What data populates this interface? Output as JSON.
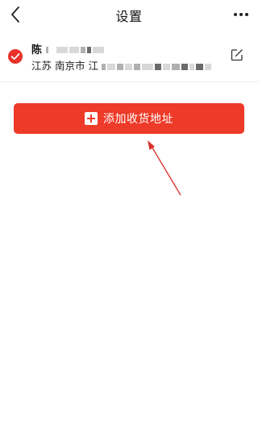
{
  "nav": {
    "title": "设置",
    "back_icon": "chevron-left-icon",
    "more_icon": "more-dots-icon"
  },
  "address": {
    "name": "陈",
    "region": "江苏 南京市 江",
    "selected": true,
    "check_icon": "check-circle-icon",
    "edit_icon": "edit-icon"
  },
  "add_button": {
    "label": "添加收货地址",
    "icon": "plus-square-icon"
  },
  "colors": {
    "accent": "#ee3a28",
    "annotation_arrow": "#d9302a"
  }
}
